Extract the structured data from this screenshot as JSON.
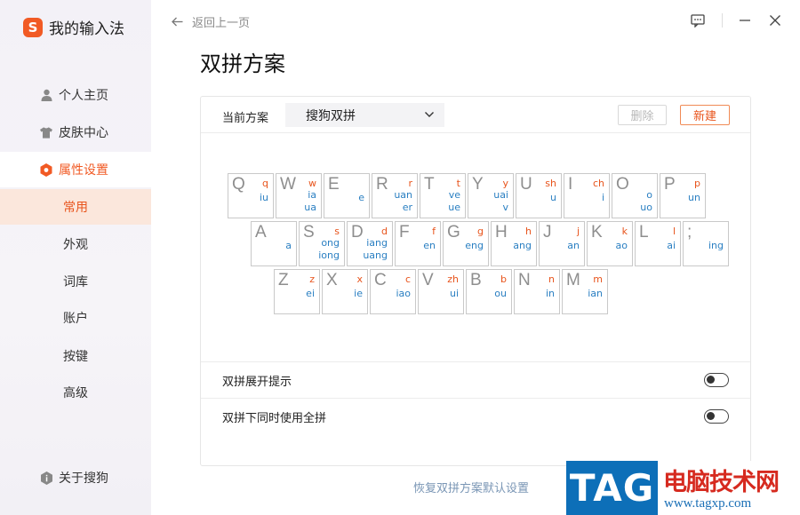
{
  "sidebar": {
    "brand": {
      "logo_letter": "S",
      "name": "我的输入法",
      "accent": "#f15a24"
    },
    "nav": [
      {
        "label": "个人主页",
        "icon": "user-icon"
      },
      {
        "label": "皮肤中心",
        "icon": "tshirt-icon"
      },
      {
        "label": "属性设置",
        "icon": "settings-hex-icon",
        "active": true
      }
    ],
    "sub": [
      {
        "label": "常用",
        "active": true
      },
      {
        "label": "外观"
      },
      {
        "label": "词库"
      },
      {
        "label": "账户"
      },
      {
        "label": "按键"
      },
      {
        "label": "高级"
      }
    ],
    "about": {
      "label": "关于搜狗",
      "icon": "info-shield-icon"
    }
  },
  "header": {
    "back_label": "返回上一页",
    "title": "双拼方案"
  },
  "scheme": {
    "label": "当前方案",
    "selected": "搜狗双拼",
    "delete_label": "删除",
    "new_label": "新建"
  },
  "keyboard": {
    "rows": [
      [
        {
          "k": "Q",
          "i": "q",
          "f": [
            "iu"
          ]
        },
        {
          "k": "W",
          "i": "w",
          "f": [
            "ia",
            "ua"
          ]
        },
        {
          "k": "E",
          "i": "",
          "f": [
            "e"
          ]
        },
        {
          "k": "R",
          "i": "r",
          "f": [
            "uan",
            "er"
          ]
        },
        {
          "k": "T",
          "i": "t",
          "f": [
            "ve",
            "ue"
          ]
        },
        {
          "k": "Y",
          "i": "y",
          "f": [
            "uai",
            "v"
          ]
        },
        {
          "k": "U",
          "i": "sh",
          "f": [
            "u"
          ]
        },
        {
          "k": "I",
          "i": "ch",
          "f": [
            "i"
          ]
        },
        {
          "k": "O",
          "i": "",
          "f": [
            "o",
            "uo"
          ]
        },
        {
          "k": "P",
          "i": "p",
          "f": [
            "un"
          ]
        }
      ],
      [
        {
          "k": "A",
          "i": "",
          "f": [
            "a"
          ]
        },
        {
          "k": "S",
          "i": "s",
          "f": [
            "ong",
            "iong"
          ]
        },
        {
          "k": "D",
          "i": "d",
          "f": [
            "iang",
            "uang"
          ]
        },
        {
          "k": "F",
          "i": "f",
          "f": [
            "en"
          ]
        },
        {
          "k": "G",
          "i": "g",
          "f": [
            "eng"
          ]
        },
        {
          "k": "H",
          "i": "h",
          "f": [
            "ang"
          ]
        },
        {
          "k": "J",
          "i": "j",
          "f": [
            "an"
          ]
        },
        {
          "k": "K",
          "i": "k",
          "f": [
            "ao"
          ]
        },
        {
          "k": "L",
          "i": "l",
          "f": [
            "ai"
          ]
        },
        {
          "k": ";",
          "i": "",
          "f": [
            "ing"
          ]
        }
      ],
      [
        {
          "k": "Z",
          "i": "z",
          "f": [
            "ei"
          ]
        },
        {
          "k": "X",
          "i": "x",
          "f": [
            "ie"
          ]
        },
        {
          "k": "C",
          "i": "c",
          "f": [
            "iao"
          ]
        },
        {
          "k": "V",
          "i": "zh",
          "f": [
            "ui"
          ]
        },
        {
          "k": "B",
          "i": "b",
          "f": [
            "ou"
          ]
        },
        {
          "k": "N",
          "i": "n",
          "f": [
            "in"
          ]
        },
        {
          "k": "M",
          "i": "m",
          "f": [
            "ian"
          ]
        }
      ]
    ],
    "colors": {
      "initial": "#e8541c",
      "final": "#2a7fc2",
      "key_letter": "#8e8e8e"
    }
  },
  "options": [
    {
      "label": "双拼展开提示",
      "on": false
    },
    {
      "label": "双拼下同时使用全拼",
      "on": false
    }
  ],
  "restore_label": "恢复双拼方案默认设置",
  "watermark": {
    "tag": "TAG",
    "cn": "电脑技术网",
    "url": "www.tagxp.com"
  }
}
